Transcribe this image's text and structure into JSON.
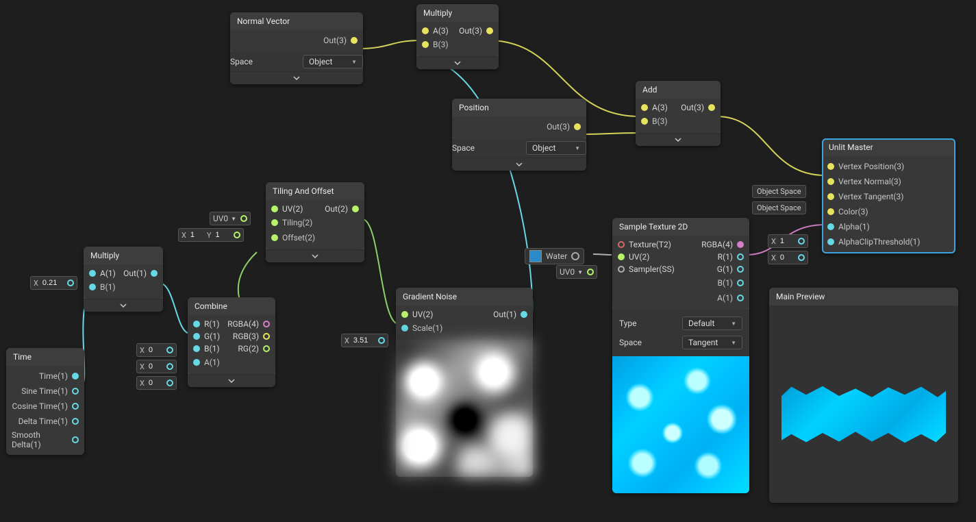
{
  "nodes": {
    "normal": {
      "title": "Normal Vector",
      "out": "Out(3)",
      "prop": "Space",
      "option": "Object"
    },
    "multiply1": {
      "title": "Multiply",
      "a": "A(3)",
      "b": "B(3)",
      "out": "Out(3)"
    },
    "position": {
      "title": "Position",
      "out": "Out(3)",
      "prop": "Space",
      "option": "Object"
    },
    "add": {
      "title": "Add",
      "a": "A(3)",
      "b": "B(3)",
      "out": "Out(3)"
    },
    "tiling": {
      "title": "Tiling And Offset",
      "uv": "UV(2)",
      "tiling": "Tiling(2)",
      "offset": "Offset(2)",
      "out": "Out(2)"
    },
    "multiply2": {
      "title": "Multiply",
      "a": "A(1)",
      "b": "B(1)",
      "out": "Out(1)"
    },
    "combine": {
      "title": "Combine",
      "r": "R(1)",
      "g": "G(1)",
      "b": "B(1)",
      "a": "A(1)",
      "rgba": "RGBA(4)",
      "rgb": "RGB(3)",
      "rg": "RG(2)"
    },
    "time": {
      "title": "Time",
      "t": "Time(1)",
      "st": "Sine Time(1)",
      "ct": "Cosine Time(1)",
      "dt": "Delta Time(1)",
      "sdt": "Smooth Delta(1)"
    },
    "noise": {
      "title": "Gradient Noise",
      "uv": "UV(2)",
      "scale": "Scale(1)",
      "out": "Out(1)"
    },
    "sample": {
      "title": "Sample Texture 2D",
      "tex": "Texture(T2)",
      "uv": "UV(2)",
      "samp": "Sampler(SS)",
      "rgba": "RGBA(4)",
      "r": "R(1)",
      "g": "G(1)",
      "b": "B(1)",
      "a": "A(1)",
      "propType": "Type",
      "optType": "Default",
      "propSpace": "Space",
      "optSpace": "Tangent"
    },
    "master": {
      "title": "Unlit Master",
      "vp": "Vertex Position(3)",
      "vn": "Vertex Normal(3)",
      "vt": "Vertex Tangent(3)",
      "col": "Color(3)",
      "alpha": "Alpha(1)",
      "act": "AlphaClipThreshold(1)"
    },
    "preview": {
      "title": "Main Preview"
    }
  },
  "ext": {
    "mult2_a": {
      "k": "X",
      "v": "0.21"
    },
    "uv0": "UV0",
    "tiling_xy": {
      "kx": "X",
      "vx": "1",
      "ky": "Y",
      "vy": "1"
    },
    "combine_g": {
      "k": "X",
      "v": "0"
    },
    "combine_b": {
      "k": "X",
      "v": "0"
    },
    "combine_a": {
      "k": "X",
      "v": "0"
    },
    "noise_scale": {
      "k": "X",
      "v": "3.51"
    },
    "sample_uv": "UV0",
    "water": "Water",
    "objspace": "Object Space",
    "master_alpha": {
      "k": "X",
      "v": "1"
    },
    "master_act": {
      "k": "X",
      "v": "0"
    }
  }
}
